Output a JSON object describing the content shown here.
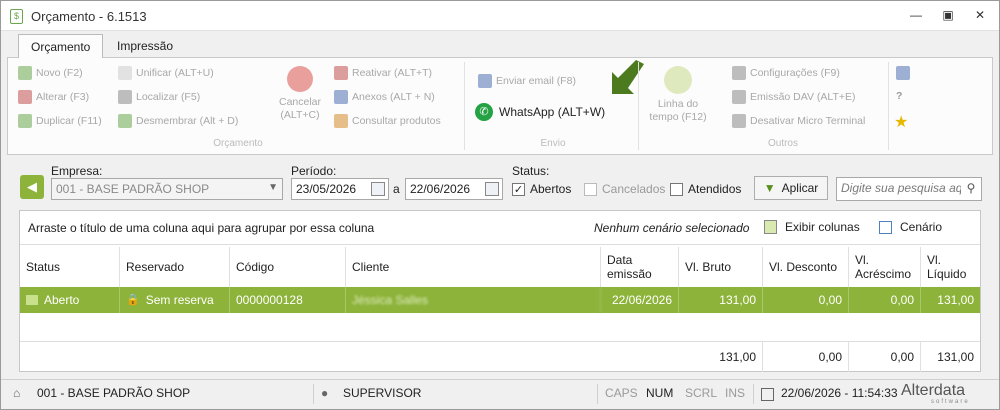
{
  "window": {
    "title": "Orçamento - 6.1513",
    "app_icon_glyph": "$"
  },
  "tabs": [
    {
      "label": "Orçamento",
      "active": true
    },
    {
      "label": "Impressão",
      "active": false
    }
  ],
  "ribbon": {
    "orcamento": {
      "group": "Orçamento",
      "novo": "Novo (F2)",
      "alterar": "Alterar (F3)",
      "duplicar": "Duplicar (F11)",
      "unificar": "Unificar (ALT+U)",
      "localizar": "Localizar (F5)",
      "desmembrar": "Desmembrar (Alt + D)",
      "cancelar": "Cancelar (ALT+C)",
      "reativar": "Reativar (ALT+T)",
      "anexos": "Anexos (ALT + N)",
      "consultar": "Consultar produtos"
    },
    "envio": {
      "group": "Envio",
      "email": "Enviar email (F8)",
      "whatsapp": "WhatsApp (ALT+W)"
    },
    "outros": {
      "group": "Outros",
      "linha": "Linha do tempo (F12)",
      "config": "Configurações (F9)",
      "emissao": "Emissão DAV (ALT+E)",
      "desativar": "Desativar Micro Terminal"
    }
  },
  "filters": {
    "empresa_label": "Empresa:",
    "empresa_value": "001 - BASE PADRÃO SHOP",
    "periodo_label": "Período:",
    "periodo_from": "23/05/2026",
    "periodo_sep": "a",
    "periodo_to": "22/06/2026",
    "status_label": "Status:",
    "status": [
      {
        "label": "Abertos",
        "checked": true
      },
      {
        "label": "Cancelados",
        "checked": false
      },
      {
        "label": "Atendidos",
        "checked": false
      }
    ],
    "aplicar": "Aplicar",
    "search_placeholder": "Digite sua pesquisa aqui"
  },
  "grid": {
    "group_hint": "Arraste o título de uma coluna aqui para agrupar por essa coluna",
    "scenario_text": "Nenhum cenário selecionado",
    "exibir_colunas": "Exibir colunas",
    "cenario": "Cenário",
    "columns": [
      "Status",
      "Reservado",
      "Código",
      "Cliente",
      "Data emissão",
      "Vl. Bruto",
      "Vl. Desconto",
      "Vl. Acréscimo",
      "Vl. Líquido"
    ],
    "rows": [
      {
        "status": "Aberto",
        "reservado": "Sem reserva",
        "codigo": "0000000128",
        "cliente": "Jéssica Salles",
        "data": "22/06/2026",
        "bruto": "131,00",
        "desconto": "0,00",
        "acrescimo": "0,00",
        "liquido": "131,00"
      }
    ],
    "totals": {
      "bruto": "131,00",
      "desconto": "0,00",
      "acrescimo": "0,00",
      "liquido": "131,00"
    }
  },
  "statusbar": {
    "empresa": "001 - BASE PADRÃO SHOP",
    "usuario": "SUPERVISOR",
    "caps": "CAPS",
    "num": "NUM",
    "scrl": "SCRL",
    "ins": "INS",
    "datetime": "22/06/2026 - 11:54:33",
    "brand": "Alterdata",
    "brand_sub": "software"
  },
  "colors": {
    "accent_green": "#8db33a",
    "whatsapp": "#25a244"
  }
}
